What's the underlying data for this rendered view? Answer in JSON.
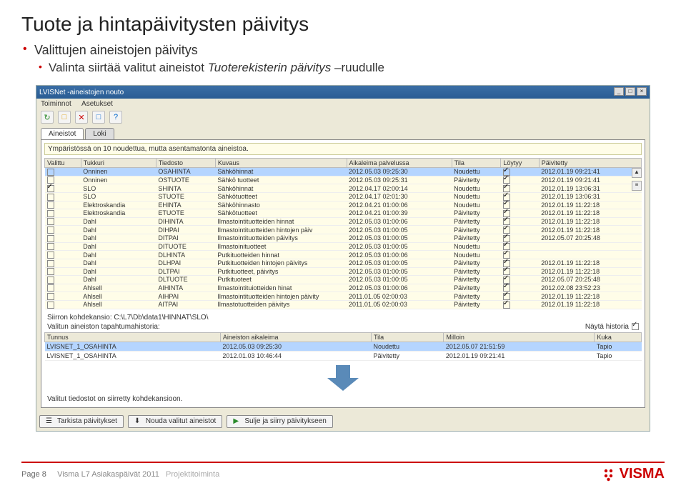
{
  "slide": {
    "title": "Tuote ja hintapäivitysten päivitys",
    "bullet1": "Valittujen aineistojen päivitys",
    "bullet1a_a": "Valinta siirtää valitut aineistot ",
    "bullet1a_i": "Tuoterekisterin päivitys",
    "bullet1a_b": " –ruudulle"
  },
  "app": {
    "title": "LVISNet -aineistojen nouto",
    "menu": {
      "m1": "Toiminnot",
      "m2": "Asetukset"
    },
    "toolbar_icons": [
      "↻",
      "□",
      "✕",
      "□",
      "?"
    ],
    "tabs": {
      "t1": "Aineistot",
      "t2": "Loki"
    },
    "notice": "Ympäristössä on 10 noudettua, mutta asentamatonta aineistoa.",
    "columns": {
      "c0": "Valittu",
      "c1": "Tukkuri",
      "c2": "Tiedosto",
      "c3": "Kuvaus",
      "c4": "Aikaleima palvelussa",
      "c5": "Tila",
      "c6": "Löytyy",
      "c7": "Päivitetty"
    },
    "rows": [
      {
        "sel": true,
        "v": false,
        "tuk": "Onninen",
        "tie": "OSAHINTA",
        "kuv": "Sähköhinnat",
        "aik": "2012.05.03 09:25:30",
        "til": "Noudettu",
        "loy": true,
        "pai": "2012.01.19 09:21:41"
      },
      {
        "sel": false,
        "v": false,
        "tuk": "Onninen",
        "tie": "OSTUOTE",
        "kuv": "Sähkö tuotteet",
        "aik": "2012.05.03 09:25:31",
        "til": "Päivitetty",
        "loy": true,
        "pai": "2012.01.19 09:21:41"
      },
      {
        "sel": false,
        "v": true,
        "tuk": "SLO",
        "tie": "SHINTA",
        "kuv": "Sähköhinnat",
        "aik": "2012.04.17 02:00:14",
        "til": "Noudettu",
        "loy": true,
        "pai": "2012.01.19 13:06:31"
      },
      {
        "sel": false,
        "v": false,
        "tuk": "SLO",
        "tie": "STUOTE",
        "kuv": "Sähkötuotteet",
        "aik": "2012.04.17 02:01:30",
        "til": "Noudettu",
        "loy": true,
        "pai": "2012.01.19 13:06:31"
      },
      {
        "sel": false,
        "v": false,
        "tuk": "Elektroskandia",
        "tie": "EHINTA",
        "kuv": "Sähköhinnasto",
        "aik": "2012.04.21 01:00:06",
        "til": "Noudettu",
        "loy": true,
        "pai": "2012.01.19 11:22:18"
      },
      {
        "sel": false,
        "v": false,
        "tuk": "Elektroskandia",
        "tie": "ETUOTE",
        "kuv": "Sähkötuotteet",
        "aik": "2012.04.21 01:00:39",
        "til": "Päivitetty",
        "loy": true,
        "pai": "2012.01.19 11:22:18"
      },
      {
        "sel": false,
        "v": false,
        "tuk": "Dahl",
        "tie": "DIHINTA",
        "kuv": "Ilmastointituotteiden hinnat",
        "aik": "2012.05.03 01:00:06",
        "til": "Päivitetty",
        "loy": true,
        "pai": "2012.01.19 11:22:18"
      },
      {
        "sel": false,
        "v": false,
        "tuk": "Dahl",
        "tie": "DIHPAI",
        "kuv": "Ilmastointituotteiden hintojen päiv",
        "aik": "2012.05.03 01:00:05",
        "til": "Päivitetty",
        "loy": true,
        "pai": "2012.01.19 11:22:18"
      },
      {
        "sel": false,
        "v": false,
        "tuk": "Dahl",
        "tie": "DITPAI",
        "kuv": "Ilmastointituotteiden päivitys",
        "aik": "2012.05.03 01:00:05",
        "til": "Päivitetty",
        "loy": true,
        "pai": "2012.05.07 20:25:48"
      },
      {
        "sel": false,
        "v": false,
        "tuk": "Dahl",
        "tie": "DITUOTE",
        "kuv": "Ilmastoinituotteet",
        "aik": "2012.05.03 01:00:05",
        "til": "Noudettu",
        "loy": true,
        "pai": ""
      },
      {
        "sel": false,
        "v": false,
        "tuk": "Dahl",
        "tie": "DLHINTA",
        "kuv": "Putkituotteiden hinnat",
        "aik": "2012.05.03 01:00:06",
        "til": "Noudettu",
        "loy": true,
        "pai": ""
      },
      {
        "sel": false,
        "v": false,
        "tuk": "Dahl",
        "tie": "DLHPAI",
        "kuv": "Putkituotteiden hintojen päivitys",
        "aik": "2012.05.03 01:00:05",
        "til": "Päivitetty",
        "loy": true,
        "pai": "2012.01.19 11:22:18"
      },
      {
        "sel": false,
        "v": false,
        "tuk": "Dahl",
        "tie": "DLTPAI",
        "kuv": "Putkituotteet, päivitys",
        "aik": "2012.05.03 01:00:05",
        "til": "Päivitetty",
        "loy": true,
        "pai": "2012.01.19 11:22:18"
      },
      {
        "sel": false,
        "v": false,
        "tuk": "Dahl",
        "tie": "DLTUOTE",
        "kuv": "Putkituoteet",
        "aik": "2012.05.03 01:00:05",
        "til": "Päivitetty",
        "loy": true,
        "pai": "2012.05.07 20:25:48"
      },
      {
        "sel": false,
        "v": false,
        "tuk": "Ahlsell",
        "tie": "AIHINTA",
        "kuv": "Ilmastointituiotteiden hinat",
        "aik": "2012.05.03 01:00:06",
        "til": "Päivitetty",
        "loy": true,
        "pai": "2012.02.08 23:52:23"
      },
      {
        "sel": false,
        "v": false,
        "tuk": "Ahlsell",
        "tie": "AIHPAI",
        "kuv": "Ilmastointituotteiden hintojen päivity",
        "aik": "2011.01.05 02:00:03",
        "til": "Päivitetty",
        "loy": true,
        "pai": "2012.01.19 11:22:18"
      },
      {
        "sel": false,
        "v": false,
        "tuk": "Ahlsell",
        "tie": "AITPAI",
        "kuv": "Ilmastotuotteiden päivitys",
        "aik": "2011.01.05 02:00:03",
        "til": "Päivitetty",
        "loy": true,
        "pai": "2012.01.19 11:22:18"
      }
    ],
    "path_label": "Siirron kohdekansio: C:\\L7\\Db\\data1\\HINNAT\\SLO\\",
    "history_label": "Näytä historia",
    "history_header": "Valitun aineiston tapahtumahistoria:",
    "hist_cols": {
      "h0": "Tunnus",
      "h1": "Aineiston aikaleima",
      "h2": "Tila",
      "h3": "Milloin",
      "h4": "Kuka"
    },
    "hist_rows": [
      {
        "sel": true,
        "t": "LVISNET_1_OSAHINTA",
        "a": "2012.05.03 09:25:30",
        "ti": "Noudettu",
        "m": "2012.05.07 21:51:59",
        "k": "Tapio"
      },
      {
        "sel": false,
        "t": "LVISNET_1_OSAHINTA",
        "a": "2012.01.03 10:46:44",
        "ti": "Päivitetty",
        "m": "2012.01.19 09:21:41",
        "k": "Tapio"
      }
    ],
    "status": "Valitut tiedostot on siirretty kohdekansioon.",
    "buttons": {
      "b1": "Tarkista päivitykset",
      "b2": "Nouda valitut aineistot",
      "b3": "Sulje ja siirry päivitykseen"
    }
  },
  "footer": {
    "page": "Page 8",
    "event": "Visma L7 Asiakaspäivät 2011",
    "topic": "Projektitoiminta",
    "logo": "VISMA"
  }
}
